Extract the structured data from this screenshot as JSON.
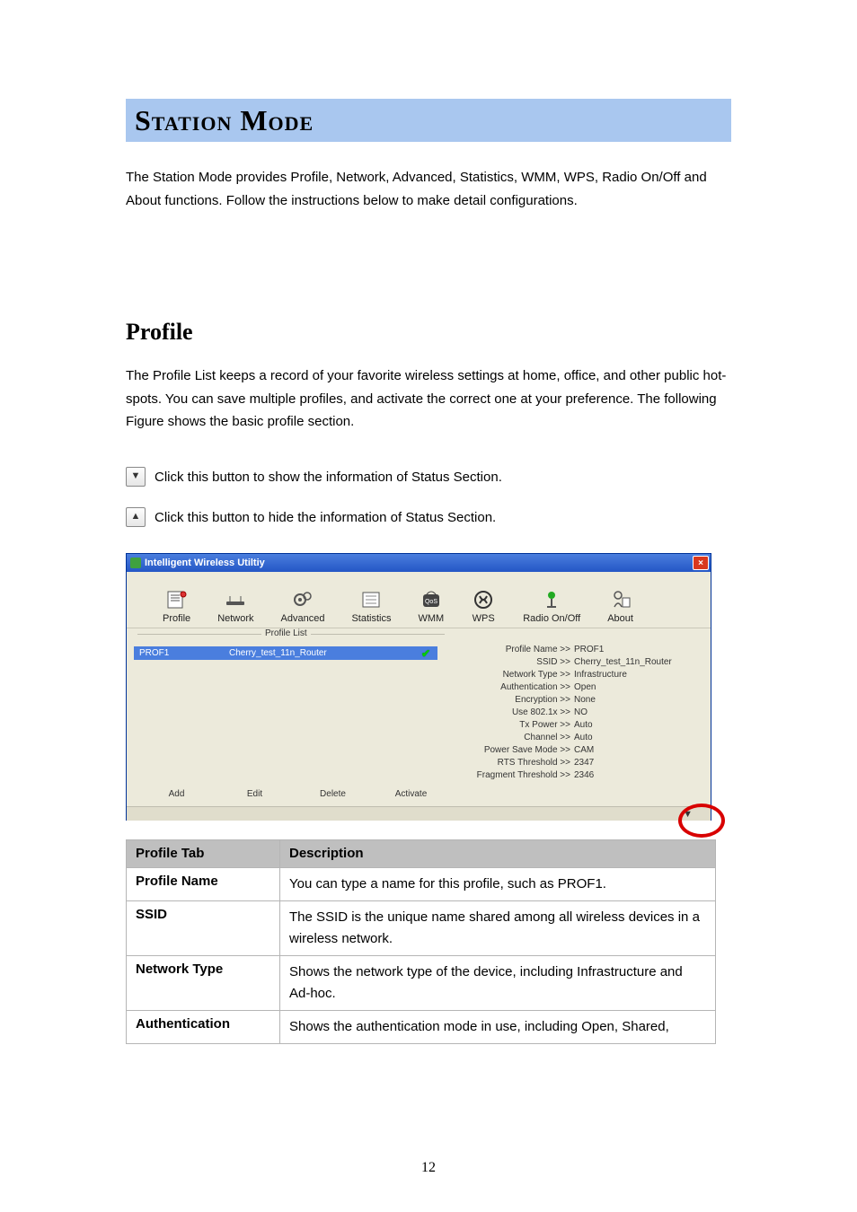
{
  "page": {
    "banner_title": "Station Mode",
    "intro": "The Station Mode provides Profile, Network, Advanced, Statistics, WMM, WPS, Radio On/Off and About functions. Follow the instructions below to make detail configurations.",
    "section_title": "Profile",
    "section_body": "The Profile List keeps a record of your favorite wireless settings at home, office, and other public hot-spots. You can save multiple profiles, and activate the correct one at your preference. The following Figure shows the basic profile section.",
    "legend_show": "Click this button to show the information of Status Section.",
    "legend_hide": "Click this button to hide the information of Status Section.",
    "page_number": "12"
  },
  "arrows": {
    "down_glyph": "▼",
    "up_glyph": "▲"
  },
  "app": {
    "title": "Intelligent Wireless Utiltiy",
    "close_glyph": "×",
    "toolbar": [
      {
        "key": "profile",
        "label": "Profile"
      },
      {
        "key": "network",
        "label": "Network"
      },
      {
        "key": "advanced",
        "label": "Advanced"
      },
      {
        "key": "statistics",
        "label": "Statistics"
      },
      {
        "key": "wmm",
        "label": "WMM"
      },
      {
        "key": "wps",
        "label": "WPS"
      },
      {
        "key": "radio",
        "label": "Radio On/Off"
      },
      {
        "key": "about",
        "label": "About"
      }
    ],
    "profile_list_label": "Profile List",
    "selected_profile": {
      "name": "PROF1",
      "ssid": "Cherry_test_11n_Router"
    },
    "actions": {
      "add": "Add",
      "edit": "Edit",
      "delete": "Delete",
      "activate": "Activate"
    },
    "details": [
      {
        "label": "Profile Name >>",
        "value": "PROF1"
      },
      {
        "label": "SSID >>",
        "value": "Cherry_test_11n_Router"
      },
      {
        "label": "Network Type >>",
        "value": "Infrastructure"
      },
      {
        "label": "Authentication >>",
        "value": "Open"
      },
      {
        "label": "Encryption >>",
        "value": "None"
      },
      {
        "label": "Use 802.1x >>",
        "value": "NO"
      },
      {
        "label": "Tx Power >>",
        "value": "Auto"
      },
      {
        "label": "Channel >>",
        "value": "Auto"
      },
      {
        "label": "Power Save Mode >>",
        "value": "CAM"
      },
      {
        "label": "RTS Threshold >>",
        "value": "2347"
      },
      {
        "label": "Fragment Threshold >>",
        "value": "2346"
      }
    ],
    "expand_glyph": "▼"
  },
  "table": {
    "head_a": "Profile Tab",
    "head_b": "Description",
    "rows": [
      {
        "a": "Profile Name",
        "b": "You can type a name for this profile, such as PROF1."
      },
      {
        "a": "SSID",
        "b": "The SSID is the unique name shared among all wireless devices in a wireless network."
      },
      {
        "a": "Network Type",
        "b": "Shows the network type of the device, including Infrastructure and Ad-hoc."
      },
      {
        "a": "Authentication",
        "b": "Shows the authentication mode in use, including Open, Shared,"
      }
    ]
  }
}
